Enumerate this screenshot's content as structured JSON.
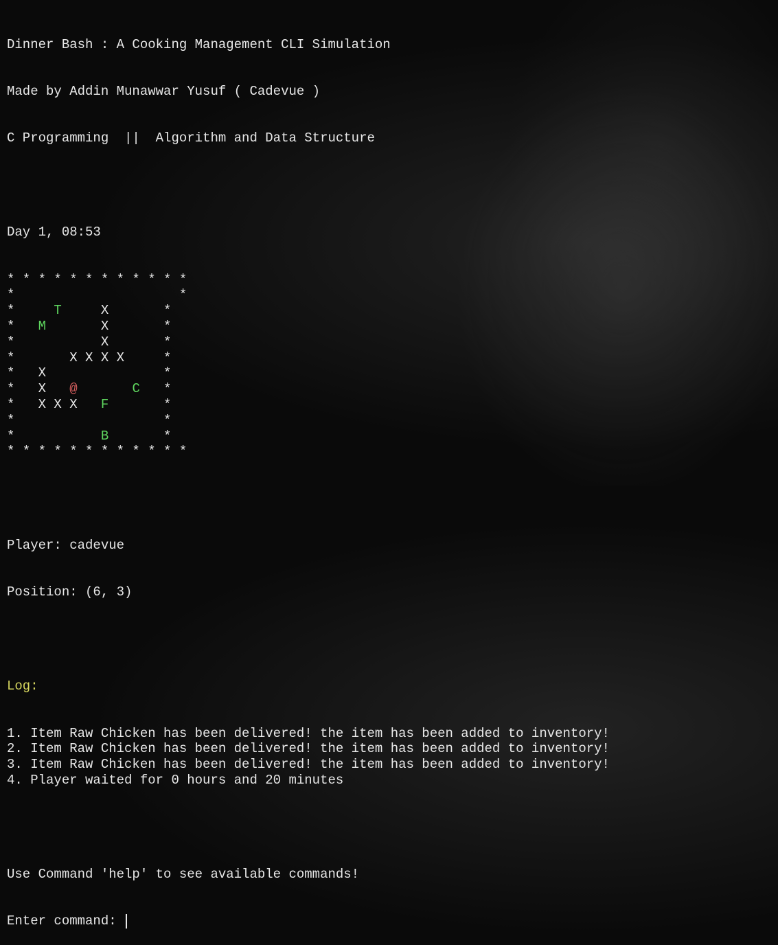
{
  "header": {
    "title": "Dinner Bash : A Cooking Management CLI Simulation",
    "author": "Made by Addin Munawwar Yusuf ( Cadevue )",
    "course": "C Programming  ||  Algorithm and Data Structure"
  },
  "game": {
    "day_time": "Day 1, 08:53",
    "map": {
      "rows": [
        [
          {
            "t": "* * * * * * * * * * * *",
            "c": "white"
          }
        ],
        [
          {
            "t": "*                     *",
            "c": "white"
          }
        ],
        [
          {
            "t": "*     ",
            "c": "white"
          },
          {
            "t": "T",
            "c": "green"
          },
          {
            "t": "     X       *",
            "c": "white"
          }
        ],
        [
          {
            "t": "*   ",
            "c": "white"
          },
          {
            "t": "M",
            "c": "green"
          },
          {
            "t": "       X       *",
            "c": "white"
          }
        ],
        [
          {
            "t": "*           X       *",
            "c": "white"
          }
        ],
        [
          {
            "t": "*       X X X X     *",
            "c": "white"
          }
        ],
        [
          {
            "t": "*   X               *",
            "c": "white"
          }
        ],
        [
          {
            "t": "*   X   ",
            "c": "white"
          },
          {
            "t": "@",
            "c": "red"
          },
          {
            "t": "       ",
            "c": "white"
          },
          {
            "t": "C",
            "c": "green"
          },
          {
            "t": "   *",
            "c": "white"
          }
        ],
        [
          {
            "t": "*   X X X   ",
            "c": "white"
          },
          {
            "t": "F",
            "c": "green"
          },
          {
            "t": "       *",
            "c": "white"
          }
        ],
        [
          {
            "t": "*                   *",
            "c": "white"
          }
        ],
        [
          {
            "t": "*           ",
            "c": "white"
          },
          {
            "t": "B",
            "c": "green"
          },
          {
            "t": "       *",
            "c": "white"
          }
        ],
        [
          {
            "t": "* * * * * * * * * * * *",
            "c": "white"
          }
        ]
      ]
    },
    "player_label": "Player: ",
    "player_name": "cadevue",
    "position_label": "Position: ",
    "position_value": "(6, 3)"
  },
  "log": {
    "header": "Log:",
    "entries": [
      "1. Item Raw Chicken has been delivered! the item has been added to inventory!",
      "2. Item Raw Chicken has been delivered! the item has been added to inventory!",
      "3. Item Raw Chicken has been delivered! the item has been added to inventory!",
      "4. Player waited for 0 hours and 20 minutes"
    ]
  },
  "prompt": {
    "help_text": "Use Command 'help' to see available commands!",
    "enter_label": "Enter command: ",
    "input_value": ""
  }
}
